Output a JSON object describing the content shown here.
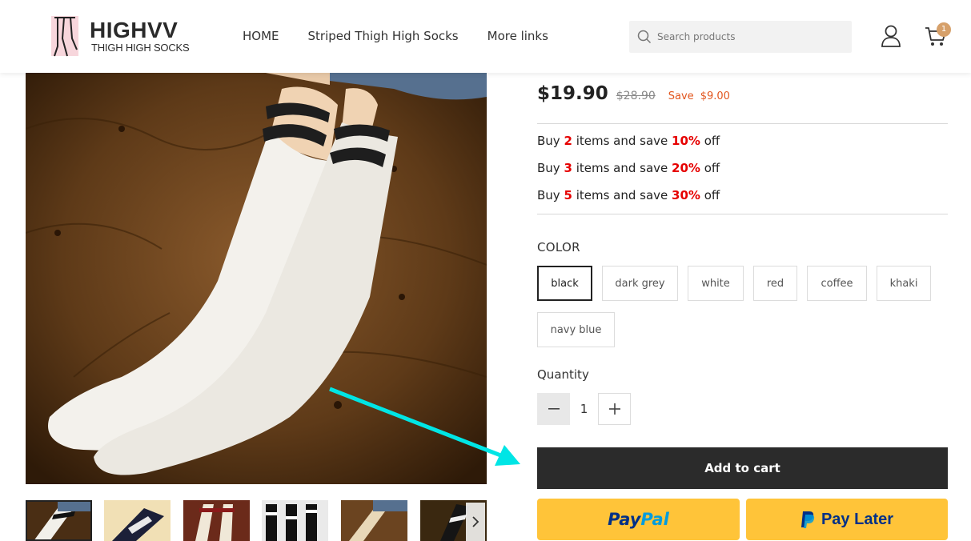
{
  "header": {
    "logo_title": "HIGHVV",
    "logo_subtitle": "THIGH HIGH SOCKS",
    "nav": [
      "HOME",
      "Striped Thigh High Socks",
      "More links"
    ],
    "search_placeholder": "Search products",
    "cart_count": "1"
  },
  "product": {
    "price": "$19.90",
    "compare_price": "$28.90",
    "save_label": "Save",
    "save_amount": "$9.00",
    "tiers": [
      {
        "prefix": "Buy",
        "qty": "2",
        "middle": "items and save",
        "pct": "10%",
        "suffix": "off"
      },
      {
        "prefix": "Buy",
        "qty": "3",
        "middle": "items and save",
        "pct": "20%",
        "suffix": "off"
      },
      {
        "prefix": "Buy",
        "qty": "5",
        "middle": "items and save",
        "pct": "30%",
        "suffix": "off"
      }
    ],
    "color_label": "COLOR",
    "colors": [
      "black",
      "dark grey",
      "white",
      "red",
      "coffee",
      "khaki",
      "navy blue"
    ],
    "selected_color": "black",
    "quantity_label": "Quantity",
    "quantity": "1",
    "add_to_cart": "Add to cart",
    "paypal_label_1": "Pay",
    "paypal_label_2": "Pal",
    "pay_later": "Pay Later"
  },
  "colors": {
    "accent_sale": "#e2561e",
    "discount_red": "#e60000",
    "cart_badge": "#d6a06a",
    "paypal_yellow": "#ffc439",
    "paypal_blue": "#003087",
    "annotation_arrow": "#00e5e5"
  }
}
